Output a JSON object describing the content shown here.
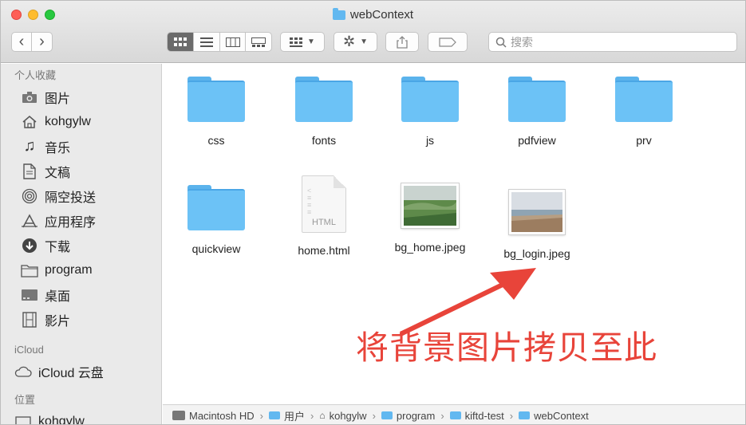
{
  "window": {
    "title": "webContext"
  },
  "toolbar": {
    "back": "‹",
    "forward": "›",
    "search_placeholder": "搜索"
  },
  "sidebar": {
    "favorites_header": "个人收藏",
    "favorites": [
      {
        "label": "图片",
        "icon": "camera-icon"
      },
      {
        "label": "kohgylw",
        "icon": "home-icon"
      },
      {
        "label": "音乐",
        "icon": "music-icon"
      },
      {
        "label": "文稿",
        "icon": "document-icon"
      },
      {
        "label": "隔空投送",
        "icon": "airdrop-icon"
      },
      {
        "label": "应用程序",
        "icon": "applications-icon"
      },
      {
        "label": "下载",
        "icon": "download-icon"
      },
      {
        "label": "program",
        "icon": "folder-icon"
      },
      {
        "label": "桌面",
        "icon": "desktop-icon"
      },
      {
        "label": "影片",
        "icon": "film-icon"
      }
    ],
    "icloud_header": "iCloud",
    "icloud_items": [
      {
        "label": "iCloud 云盘",
        "icon": "cloud-icon"
      }
    ],
    "locations_header": "位置",
    "locations": [
      {
        "label": "kohgylw",
        "icon": "computer-icon"
      }
    ]
  },
  "files": [
    {
      "name": "css",
      "type": "folder"
    },
    {
      "name": "fonts",
      "type": "folder"
    },
    {
      "name": "js",
      "type": "folder"
    },
    {
      "name": "pdfview",
      "type": "folder"
    },
    {
      "name": "prv",
      "type": "folder"
    },
    {
      "name": "quickview",
      "type": "folder"
    },
    {
      "name": "home.html",
      "type": "html",
      "tag": "HTML"
    },
    {
      "name": "bg_home.jpeg",
      "type": "image"
    },
    {
      "name": "bg_login.jpeg",
      "type": "image"
    }
  ],
  "pathbar": {
    "segments": [
      "Macintosh HD",
      "用户",
      "kohgylw",
      "program",
      "kiftd-test",
      "webContext"
    ],
    "separator": "›"
  },
  "annotation": {
    "text": "将背景图片拷贝至此",
    "color": "#e8443a"
  },
  "colors": {
    "folder": "#6cc2f6",
    "sidebar_bg": "#eaeaea",
    "arrow": "#e8443a"
  }
}
